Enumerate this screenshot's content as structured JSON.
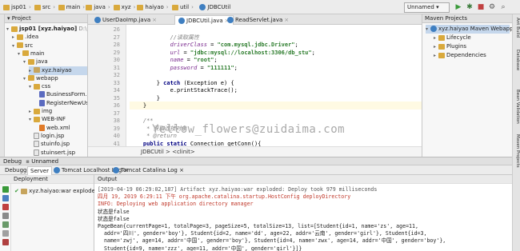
{
  "breadcrumbs": [
    "jsp01",
    "src",
    "main",
    "java",
    "xyz",
    "haiyao",
    "util",
    "JDBCUtil"
  ],
  "run_config": "Unnamed",
  "project_panel": {
    "title": "Project",
    "items": [
      {
        "label": "jsp01 [xyz.haiyao]",
        "extra": "D:\\workspace_idea\\jsp",
        "depth": 0,
        "icon": "folder",
        "arrow": "▾"
      },
      {
        "label": ".idea",
        "depth": 1,
        "icon": "folder",
        "arrow": "▸"
      },
      {
        "label": "src",
        "depth": 1,
        "icon": "folder",
        "arrow": "▾"
      },
      {
        "label": "main",
        "depth": 2,
        "icon": "folder",
        "arrow": "▾"
      },
      {
        "label": "java",
        "depth": 3,
        "icon": "folder",
        "arrow": "▾"
      },
      {
        "label": "xyz.haiyao",
        "depth": 4,
        "icon": "pkg",
        "arrow": "▸"
      },
      {
        "label": "webapp",
        "depth": 3,
        "icon": "folder",
        "arrow": "▾"
      },
      {
        "label": "css",
        "depth": 4,
        "icon": "folder",
        "arrow": "▾"
      },
      {
        "label": "BusinessForm.css",
        "depth": 5,
        "icon": "css",
        "arrow": ""
      },
      {
        "label": "RegisterNewUser.css",
        "depth": 5,
        "icon": "css",
        "arrow": ""
      },
      {
        "label": "img",
        "depth": 4,
        "icon": "folder",
        "arrow": "▸"
      },
      {
        "label": "WEB-INF",
        "depth": 4,
        "icon": "folder",
        "arrow": "▾"
      },
      {
        "label": "web.xml",
        "depth": 5,
        "icon": "xml",
        "arrow": ""
      },
      {
        "label": "login.jsp",
        "depth": 4,
        "icon": "jsp",
        "arrow": ""
      },
      {
        "label": "stuinfo.jsp",
        "depth": 4,
        "icon": "jsp",
        "arrow": ""
      },
      {
        "label": "stuinsert.jsp",
        "depth": 4,
        "icon": "jsp",
        "arrow": ""
      }
    ]
  },
  "editor": {
    "tabs": [
      "UserDaoImp.java",
      "JDBCUtil.java",
      "ReadServlet.java"
    ],
    "active_tab": 1,
    "line_numbers": [
      "26",
      "27",
      "28",
      "29",
      "30",
      "31",
      "32",
      "33",
      "34",
      "35",
      "36",
      "37",
      "38",
      "39",
      "40",
      "41"
    ],
    "lines": [
      [],
      [
        {
          "t": "            ",
          "c": "plain"
        },
        {
          "t": "//读取属性",
          "c": "cm"
        }
      ],
      [
        {
          "t": "            ",
          "c": "plain"
        },
        {
          "t": "driverClass",
          "c": "fld"
        },
        {
          "t": " = ",
          "c": "plain"
        },
        {
          "t": "\"com.mysql.jdbc.Driver\"",
          "c": "str"
        },
        {
          "t": ";",
          "c": "plain"
        }
      ],
      [
        {
          "t": "            ",
          "c": "plain"
        },
        {
          "t": "url",
          "c": "fld"
        },
        {
          "t": " = ",
          "c": "plain"
        },
        {
          "t": "\"jdbc:mysql://localhost:3306/db_stu\"",
          "c": "str"
        },
        {
          "t": ";",
          "c": "plain"
        }
      ],
      [
        {
          "t": "            ",
          "c": "plain"
        },
        {
          "t": "name",
          "c": "fld"
        },
        {
          "t": " = ",
          "c": "plain"
        },
        {
          "t": "\"root\"",
          "c": "str"
        },
        {
          "t": ";",
          "c": "plain"
        }
      ],
      [
        {
          "t": "            ",
          "c": "plain"
        },
        {
          "t": "password",
          "c": "fld"
        },
        {
          "t": " = ",
          "c": "plain"
        },
        {
          "t": "\"111111\"",
          "c": "str"
        },
        {
          "t": ";",
          "c": "plain"
        }
      ],
      [],
      [
        {
          "t": "        } ",
          "c": "plain"
        },
        {
          "t": "catch",
          "c": "kw"
        },
        {
          "t": " (Exception e) {",
          "c": "plain"
        }
      ],
      [
        {
          "t": "            e.printStackTrace();",
          "c": "plain"
        }
      ],
      [
        {
          "t": "        }",
          "c": "plain"
        }
      ],
      [
        {
          "t": "    }",
          "c": "plain"
        }
      ],
      [],
      [
        {
          "t": "    ",
          "c": "plain"
        },
        {
          "t": "/**",
          "c": "cm"
        }
      ],
      [
        {
          "t": "     ",
          "c": "plain"
        },
        {
          "t": "* 获取连接对象",
          "c": "cm"
        }
      ],
      [
        {
          "t": "     ",
          "c": "plain"
        },
        {
          "t": "* @return",
          "c": "cm"
        }
      ],
      [
        {
          "t": "    ",
          "c": "plain"
        },
        {
          "t": "public static",
          "c": "kw"
        },
        {
          "t": " Connection getConn(){",
          "c": "plain"
        }
      ]
    ],
    "watermark": "Yellow_flowers@zuidaima.com",
    "breadcrumb": "JDBCUtil  >  <clinit>"
  },
  "maven": {
    "title": "Maven Projects",
    "items": [
      {
        "label": "xyz.haiyao Maven Webapp",
        "depth": 0,
        "arrow": "▾"
      },
      {
        "label": "Lifecycle",
        "depth": 1,
        "arrow": "▸"
      },
      {
        "label": "Plugins",
        "depth": 1,
        "arrow": "▸"
      },
      {
        "label": "Dependencies",
        "depth": 1,
        "arrow": "▸"
      }
    ]
  },
  "right_tools": [
    "Ant Build",
    "Database",
    "Bean Validation",
    "Maven Projects"
  ],
  "debug": {
    "title": "Debug",
    "config": "Unnamed",
    "tabs": [
      "Debugger",
      "Server",
      "Tomcat Localhost Log",
      "Tomcat Catalina Log"
    ],
    "active_tab": 1,
    "deployment_title": "Deployment",
    "deployment_item": "xyz.haiyao:war exploded",
    "output_title": "Output",
    "output_lines": [
      {
        "t": "[2019-04-19 06:29:02,187] Artifact xyz.haiyao:war exploded: Deploy took 979 milliseconds",
        "c": "gray"
      },
      {
        "t": "四月 19, 2019 6:29:11 下午 org.apache.catalina.startup.HostConfig deployDirectory",
        "c": "err"
      },
      {
        "t": "INFO: Deploying web application directory manager",
        "c": "err"
      },
      {
        "t": "状态是false",
        "c": "blk"
      },
      {
        "t": "状态是false",
        "c": "blk"
      },
      {
        "t": "PageBean{currentPage=1, totalPage=3, pageSize=5, totalSize=13, list=[Student{id=1, name='zs', age=11,",
        "c": "blk"
      },
      {
        "t": "  addr='四川', gender='boy'}, Student{id=2, name='dd', age=22, addr='云南', gender='girl'}, Student{id=3,",
        "c": "blk"
      },
      {
        "t": "  name='zwj', age=14, addr='中国', gender='boy'}, Student{id=4, name='zwx', age=14, addr='中国', gender='boy'},",
        "c": "blk"
      },
      {
        "t": "  Student{id=9, name='zzz', age=11, addr='中国', gender='girl'}]}",
        "c": "blk"
      }
    ]
  },
  "colors": {
    "accent": "#3f7fc1",
    "selection": "#c5d7ec",
    "error_text": "#c0392b",
    "string": "#2a7b2a",
    "field": "#7a2a8f"
  }
}
